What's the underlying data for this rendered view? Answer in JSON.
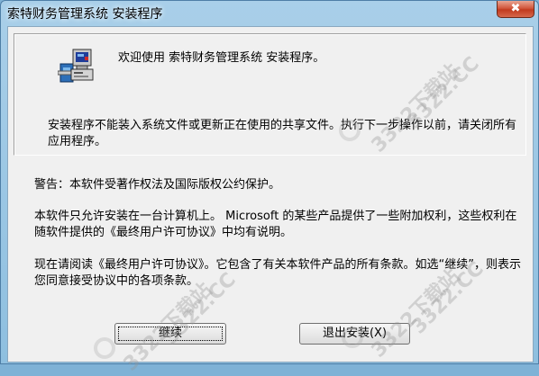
{
  "window": {
    "title": "索特财务管理系统 安装程序"
  },
  "close_button": {
    "symbol": "✖"
  },
  "panel": {
    "icon": "computer-setup-icon",
    "welcome": "欢迎使用 索特财务管理系统 安装程序。",
    "notice": "安装程序不能装入系统文件或更新正在使用的共享文件。执行下一步操作以前，请关闭所有应用程序。"
  },
  "body": {
    "warning": "警告：本软件受著作权法及国际版权公约保护。",
    "license_paragraph": "本软件只允许安装在一台计算机上。 Microsoft 的某些产品提供了一些附加权利，这些权利在随软件提供的《最终用户许可协议》中均有说明。",
    "read_paragraph": "现在请阅读《最终用户许可协议》。它包含了有关本软件产品的所有条款。如选“继续”，则表示您同意接受协议中的各项条款。"
  },
  "buttons": {
    "continue": "继续",
    "exit": "退出安装(X)"
  },
  "watermark": {
    "text": "3322下载站",
    "domain": "3322.CC"
  },
  "colors": {
    "desktop": "#7fb2d6",
    "dialog": "#f0f0f0",
    "close": "#c13a1e"
  }
}
